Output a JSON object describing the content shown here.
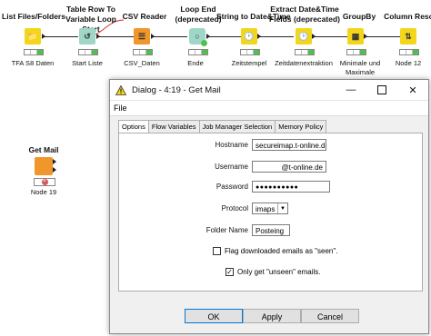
{
  "workflow": {
    "nodes": [
      {
        "title": "List Files/Folders",
        "label": "TFA S8 Daten",
        "icon": "file-folder-icon"
      },
      {
        "title": "Table Row To Variable Loop Start",
        "label": "Start Liste",
        "icon": "loop-start-icon"
      },
      {
        "title": "CSV Reader",
        "label": "CSV_Daten",
        "icon": "csv-reader-icon"
      },
      {
        "title": "Loop End (deprecated)",
        "label": "Ende",
        "icon": "loop-end-icon"
      },
      {
        "title": "String to Date&Time",
        "label": "Zeitstempel",
        "icon": "date-time-icon"
      },
      {
        "title": "Extract Date&Time Fields (deprecated)",
        "label": "Zeitdatenextraktion",
        "icon": "extract-date-icon"
      },
      {
        "title": "GroupBy",
        "label": "Minimale und Maximale Tagesstemperaturen",
        "icon": "groupby-icon"
      },
      {
        "title": "Column Reso...",
        "label": "Node 12",
        "icon": "column-resorter-icon"
      }
    ],
    "get_mail_node": {
      "title": "Get Mail",
      "label": "Node 19"
    }
  },
  "dialog": {
    "title": "Dialog - 4:19 - Get Mail",
    "menu": "File",
    "tabs": [
      "Options",
      "Flow Variables",
      "Job Manager Selection",
      "Memory Policy"
    ],
    "fields": {
      "hostname_label": "Hostname",
      "hostname_value": "secureimap.t-online.de",
      "username_label": "Username",
      "username_value": "@t-online.de",
      "password_label": "Password",
      "password_value": "●●●●●●●●●●",
      "protocol_label": "Protocol",
      "protocol_value": "imaps",
      "folder_label": "Folder Name",
      "folder_value": "Posteing"
    },
    "flag_seen_label": "Flag downloaded emails as \"seen\".",
    "flag_seen_checked": false,
    "only_unseen_label": "Only get \"unseen\" emails.",
    "only_unseen_checked": true,
    "buttons": {
      "ok": "OK",
      "apply": "Apply",
      "cancel": "Cancel"
    }
  },
  "colors": {
    "status_green": "#4fc04f",
    "status_yellow": "#f2d41b",
    "status_red": "#d65757",
    "node_orange": "#f0962a",
    "node_yellow": "#f3d51b",
    "node_teal": "#9fd6c7",
    "dialog_default_border": "#0078d7"
  }
}
